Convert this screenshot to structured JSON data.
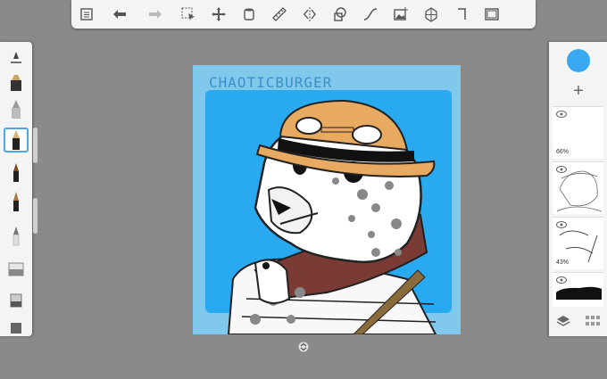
{
  "toolbar": {
    "buttons": [
      {
        "name": "menu-list-icon"
      },
      {
        "name": "undo-icon"
      },
      {
        "name": "redo-icon"
      },
      {
        "name": "selection-icon"
      },
      {
        "name": "transform-icon"
      },
      {
        "name": "fill-bucket-icon"
      },
      {
        "name": "ruler-icon"
      },
      {
        "name": "symmetry-icon"
      },
      {
        "name": "shapes-icon"
      },
      {
        "name": "curve-icon"
      },
      {
        "name": "image-import-icon"
      },
      {
        "name": "perspective-grid-icon"
      },
      {
        "name": "crop-icon"
      },
      {
        "name": "fullscreen-icon"
      }
    ]
  },
  "brushes": [
    "brush-size-slider",
    "marker-brush",
    "airbrush",
    "ballpoint-pen",
    "paint-brush",
    "ink-pen",
    "pencil",
    "eraser",
    "smudge-tool",
    "flat-brush"
  ],
  "canvas": {
    "watermark": "CHAOTICBURGER"
  },
  "layers": {
    "current_color": "#3aa8f0",
    "items": [
      {
        "opacity": "66%"
      },
      {
        "opacity": ""
      },
      {
        "opacity": "43%"
      },
      {
        "opacity": ""
      }
    ]
  },
  "colors": {
    "accent": "#3aa8f0",
    "toolbar": "#f4f4f4",
    "background": "#8a8a8a"
  }
}
